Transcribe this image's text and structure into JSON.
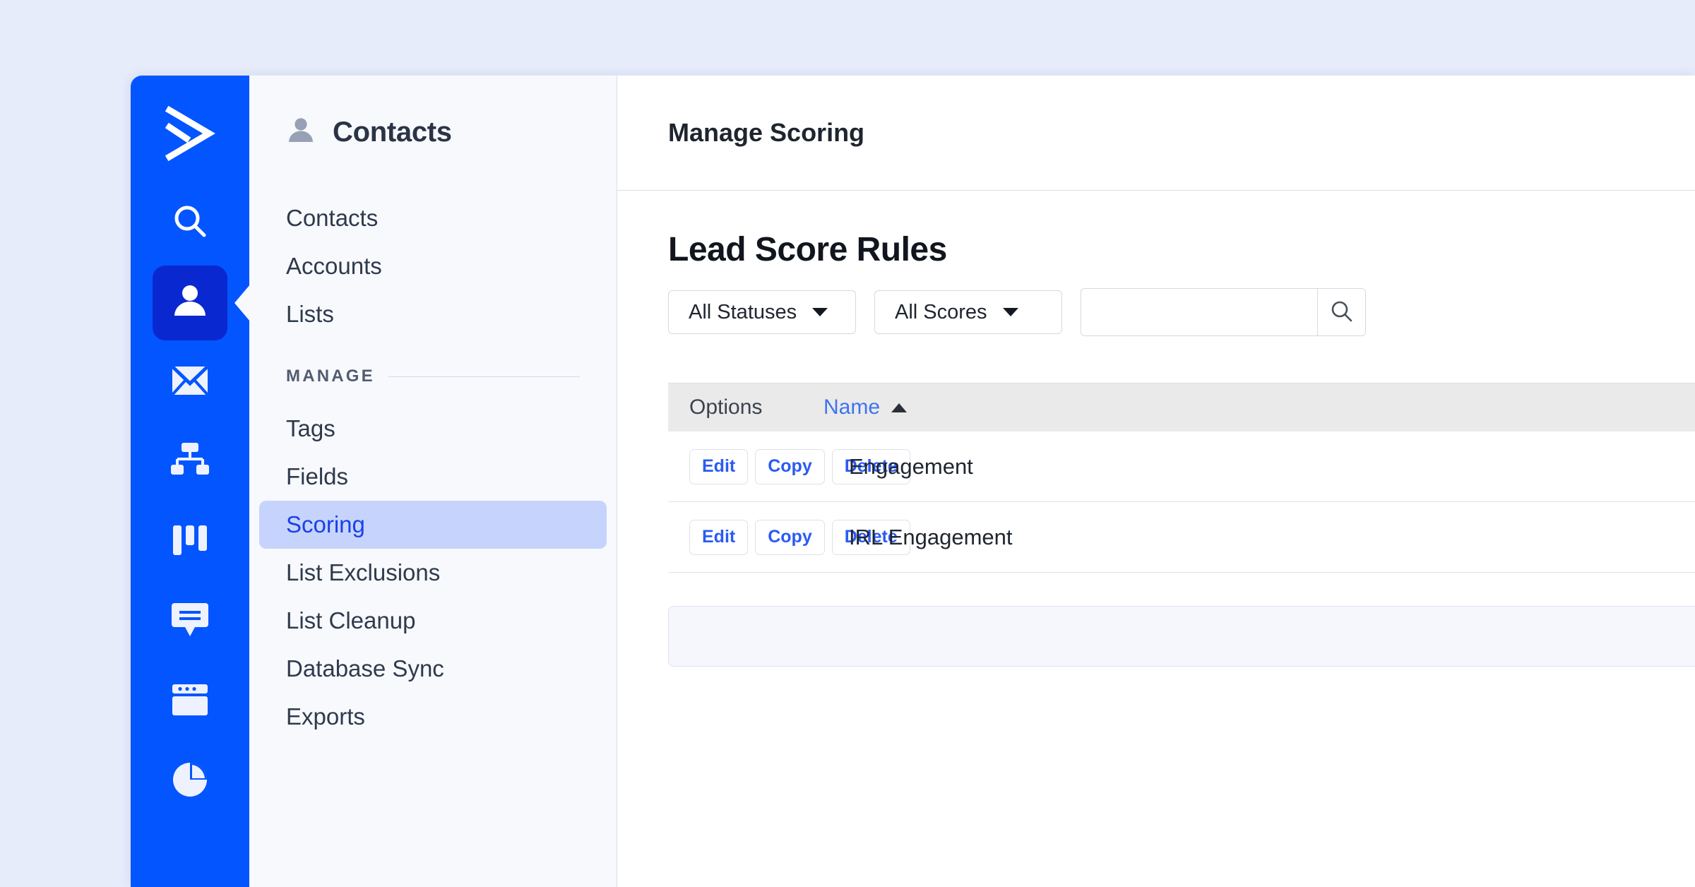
{
  "brand": {
    "accent": "#0355ff",
    "accent_dark": "#0a28cf",
    "link": "#2a5bf5",
    "page_bg": "#e7ecfb"
  },
  "rail": {
    "logo_name": "activecampaign-logo",
    "items": [
      {
        "icon": "search-icon",
        "active": false
      },
      {
        "icon": "contacts-person-icon",
        "active": true
      },
      {
        "icon": "email-envelope-icon",
        "active": false
      },
      {
        "icon": "automations-flow-icon",
        "active": false
      },
      {
        "icon": "deals-columns-icon",
        "active": false
      },
      {
        "icon": "conversations-chat-icon",
        "active": false
      },
      {
        "icon": "website-pages-icon",
        "active": false
      },
      {
        "icon": "reports-pie-icon",
        "active": false
      }
    ]
  },
  "subnav": {
    "icon": "person-icon",
    "title": "Contacts",
    "items": [
      {
        "label": "Contacts",
        "active": false
      },
      {
        "label": "Accounts",
        "active": false
      },
      {
        "label": "Lists",
        "active": false
      }
    ],
    "section_label": "MANAGE",
    "manage_items": [
      {
        "label": "Tags",
        "active": false
      },
      {
        "label": "Fields",
        "active": false
      },
      {
        "label": "Scoring",
        "active": true
      },
      {
        "label": "List Exclusions",
        "active": false
      },
      {
        "label": "List Cleanup",
        "active": false
      },
      {
        "label": "Database Sync",
        "active": false
      },
      {
        "label": "Exports",
        "active": false
      }
    ]
  },
  "main": {
    "header_title": "Manage Scoring",
    "page_title": "Lead Score Rules",
    "filters": {
      "status": {
        "label": "All Statuses",
        "icon": "chevron-down-icon"
      },
      "scores": {
        "label": "All Scores",
        "icon": "chevron-down-icon"
      },
      "search": {
        "value": "",
        "placeholder": "",
        "icon": "search-icon"
      }
    },
    "table": {
      "columns": {
        "options": "Options",
        "name": "Name"
      },
      "sort": {
        "column": "Name",
        "direction": "asc",
        "icon": "caret-up-icon"
      },
      "actions": {
        "edit": "Edit",
        "copy": "Copy",
        "delete": "Delete"
      },
      "rows": [
        {
          "name": "Engagement"
        },
        {
          "name": "IRL Engagement"
        }
      ]
    }
  }
}
